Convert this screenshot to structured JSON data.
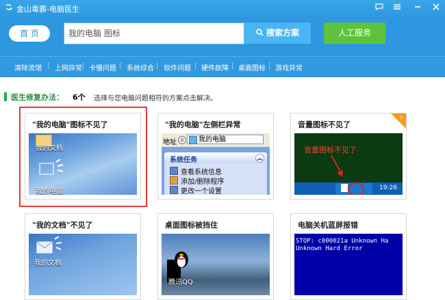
{
  "titlebar": {
    "title": "金山毒霸-电脑医生"
  },
  "header": {
    "home_label": "首 页",
    "search_value": "我的电脑 图标",
    "search_button": "搜索方案",
    "service_button": "人工服务"
  },
  "categories": [
    "清除流氓",
    "上网异常",
    "卡慢问题",
    "系统综合",
    "软件问题",
    "硬件故障",
    "桌面图标",
    "游戏异常"
  ],
  "fix": {
    "label": "医生修复办法：",
    "count": "6个",
    "description": "选择与您电脑问题相符的方案点击解决。"
  },
  "cards": [
    {
      "title": "\"我的电脑\"图标不见了",
      "thumb_labels": {
        "doc": "我的文档",
        "pc": "我的电脑"
      }
    },
    {
      "title": "\"我的电脑\"左侧栏异常",
      "thumb": {
        "address_label": "地址",
        "address_value": "我的电脑",
        "panel_title": "系统任务",
        "items": [
          "查看系统信息",
          "添加/删除程序",
          "更改一个设置"
        ]
      }
    },
    {
      "title": "音量图标不见了",
      "thumb": {
        "caption": "音量图标不见了",
        "clock": "19:26"
      }
    },
    {
      "title": "\"我的文档\"不见了",
      "thumb_labels": {
        "doc": "我的文档"
      }
    },
    {
      "title": "桌面图标被挡住",
      "thumb_labels": {
        "qq": "腾讯QQ"
      }
    },
    {
      "title": "电脑关机蓝屏报错",
      "thumb": {
        "screen_text": "STOP: c000021a Unknown Ha\nUnknown Hard Error"
      }
    }
  ]
}
